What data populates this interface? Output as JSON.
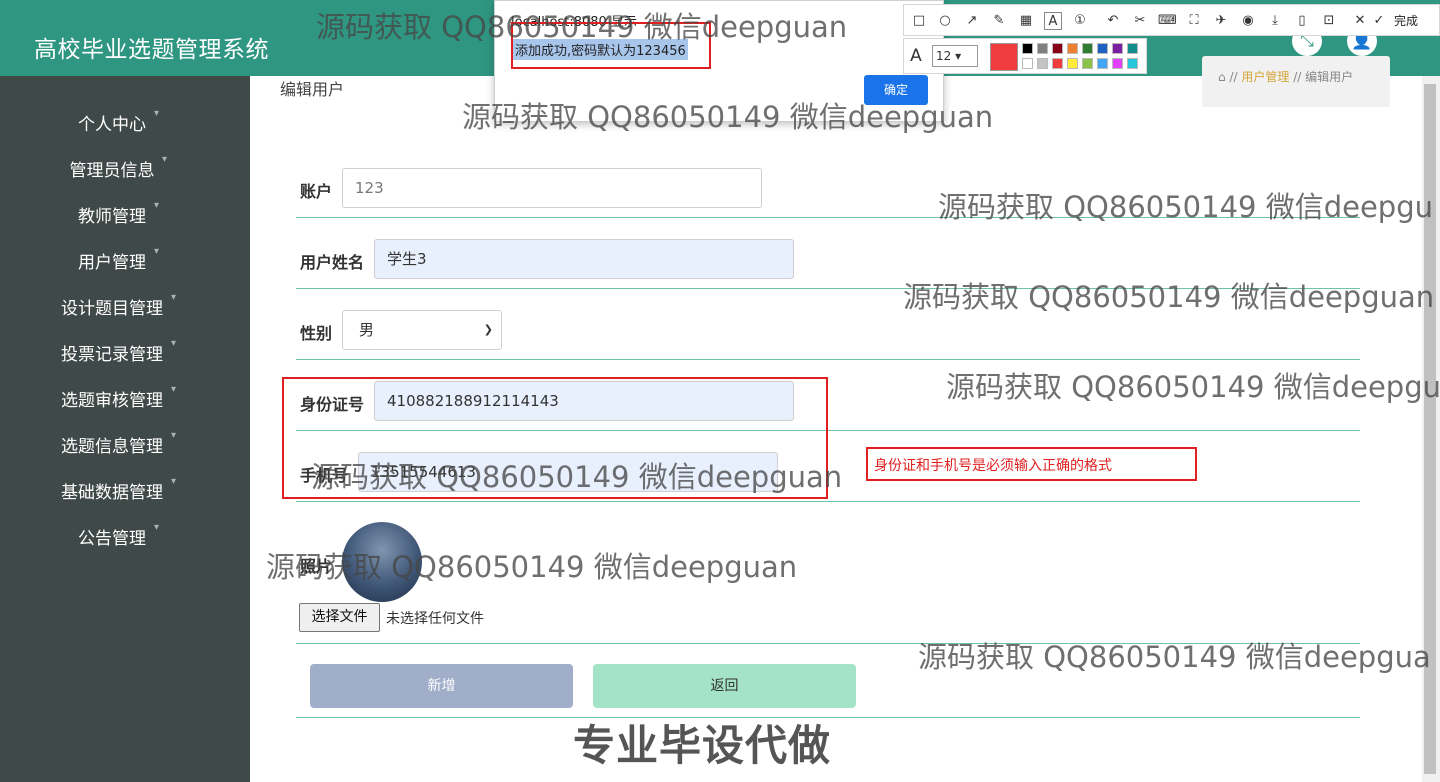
{
  "app": {
    "title": "高校毕业选题管理系统"
  },
  "header_icons": [
    "fullscreen-icon",
    "user-icon"
  ],
  "sidebar": {
    "items": [
      {
        "label": "个人中心"
      },
      {
        "label": "管理员信息"
      },
      {
        "label": "教师管理"
      },
      {
        "label": "用户管理"
      },
      {
        "label": "设计题目管理"
      },
      {
        "label": "投票记录管理"
      },
      {
        "label": "选题审核管理"
      },
      {
        "label": "选题信息管理"
      },
      {
        "label": "基础数据管理"
      },
      {
        "label": "公告管理"
      }
    ]
  },
  "page": {
    "title": "编辑用户",
    "breadcrumb": {
      "section": "用户管理",
      "current": "编辑用户",
      "separator": "//"
    }
  },
  "form": {
    "account_label": "账户",
    "account_value": "123",
    "name_label": "用户姓名",
    "name_value": "学生3",
    "gender_label": "性别",
    "gender_value": "男",
    "idcard_label": "身份证号",
    "idcard_value": "410882188912114143",
    "phone_label": "手机号",
    "phone_value": "13515544613",
    "photo_label": "照片",
    "file_button": "选择文件",
    "file_status": "未选择任何文件",
    "add_button": "新增",
    "back_button": "返回"
  },
  "annotation": {
    "note": "身份证和手机号是必须输入正确的格式"
  },
  "dialog": {
    "origin": "localhost:8080 显示",
    "message": "添加成功,密码默认为123456",
    "ok_label": "确定"
  },
  "snip_toolbar": {
    "tools": [
      "rect-icon",
      "ellipse-icon",
      "arrow-icon",
      "pen-icon",
      "mosaic-icon",
      "text-icon",
      "number-icon",
      "undo-icon",
      "cut-icon",
      "ocr-icon",
      "scan-icon",
      "pin-icon",
      "record-icon",
      "download-icon",
      "phone-icon",
      "bookmark-icon",
      "close-icon",
      "check-icon"
    ],
    "done_label": "完成",
    "font_size": "12",
    "current_color": "#f03c3c",
    "swatches": [
      "#000000",
      "#7f7f7f",
      "#880015",
      "#ed7f30",
      "#2f7d32",
      "#1f5fbf",
      "#7b1fa2",
      "#128c8c",
      "#ffffff",
      "#c3c3c3",
      "#f03c3c",
      "#ffeb3b",
      "#8bc34a",
      "#42a5f5",
      "#e040fb",
      "#26c6da"
    ]
  },
  "watermarks": [
    "源码获取 QQ86050149 微信deepguan",
    "源码获取 QQ86050149 微信deepguan",
    "源码获取 QQ86050149 微信deepgu",
    "源码获取 QQ86050149 微信deepguan",
    "源码获取 QQ86050149 微信deepgu",
    "源码获取 QQ86050149 微信deepguan",
    "源码获取 QQ86050149 微信deepguan",
    "源码获取 QQ86050149 微信deepgua"
  ],
  "footer_stamp": "专业毕设代做"
}
